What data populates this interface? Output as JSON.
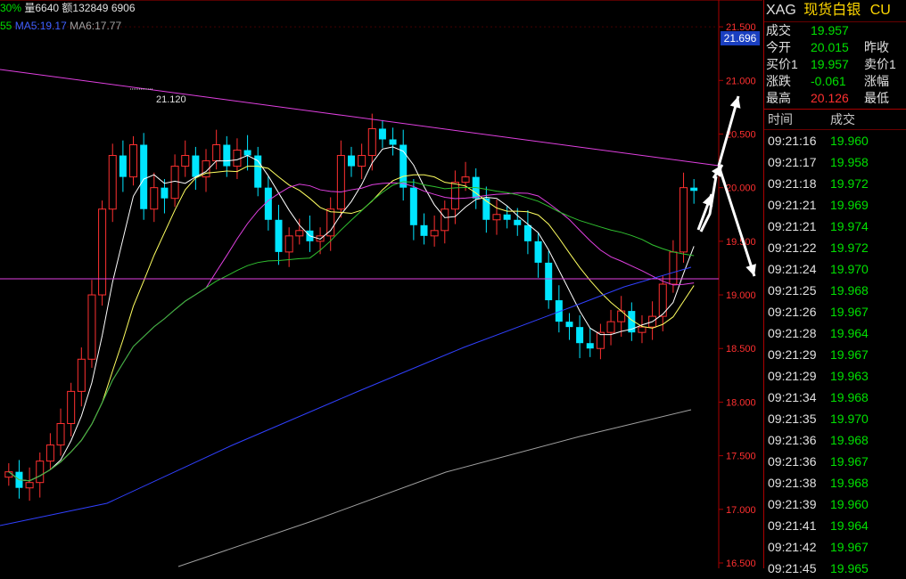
{
  "header": {
    "pct": "30%",
    "volume_label": "量6640",
    "amount_label": "额132849",
    "extra": "6906"
  },
  "ma_bar": {
    "ma_prefix": "55",
    "ma5": "MA5:19.17",
    "ma6": "MA6:17.77"
  },
  "chart": {
    "current_price_tag": "21.696",
    "high_annotation": "21.120",
    "colors": {
      "up": "#ff3030",
      "down": "#00e5ff",
      "resistance": "#e040e0",
      "support": "#e040e0"
    }
  },
  "chart_data": {
    "type": "candlestick",
    "y_ticks": [
      "21.500",
      "21.000",
      "20.500",
      "20.000",
      "19.500",
      "19.000",
      "18.500",
      "18.000",
      "17.500",
      "17.000",
      "16.500"
    ],
    "ylim": [
      16.45,
      21.75
    ]
  },
  "quote": {
    "symbol": "XAG",
    "name": "现货白银",
    "suffix": "CU",
    "rows": [
      {
        "l1": "成交",
        "v1": "19.957",
        "l2": "",
        "c": "green"
      },
      {
        "l1": "今开",
        "v1": "20.015",
        "l2": "昨收",
        "c": "green"
      },
      {
        "l1": "买价1",
        "v1": "19.957",
        "l2": "卖价1",
        "c": "green"
      },
      {
        "l1": "涨跌",
        "v1": "-0.061",
        "l2": "涨幅",
        "c": "green"
      },
      {
        "l1": "最高",
        "v1": "20.126",
        "l2": "最低",
        "c": "red"
      }
    ],
    "ticks_header": {
      "time": "时间",
      "deal": "成交"
    },
    "ticks": [
      {
        "t": "09:21:16",
        "p": "19.960"
      },
      {
        "t": "09:21:17",
        "p": "19.958"
      },
      {
        "t": "09:21:18",
        "p": "19.972"
      },
      {
        "t": "09:21:21",
        "p": "19.969"
      },
      {
        "t": "09:21:21",
        "p": "19.974"
      },
      {
        "t": "09:21:22",
        "p": "19.972"
      },
      {
        "t": "09:21:24",
        "p": "19.970"
      },
      {
        "t": "09:21:25",
        "p": "19.968"
      },
      {
        "t": "09:21:26",
        "p": "19.967"
      },
      {
        "t": "09:21:28",
        "p": "19.964"
      },
      {
        "t": "09:21:29",
        "p": "19.967"
      },
      {
        "t": "09:21:29",
        "p": "19.963"
      },
      {
        "t": "09:21:34",
        "p": "19.968"
      },
      {
        "t": "09:21:35",
        "p": "19.970"
      },
      {
        "t": "09:21:36",
        "p": "19.968"
      },
      {
        "t": "09:21:36",
        "p": "19.967"
      },
      {
        "t": "09:21:38",
        "p": "19.968"
      },
      {
        "t": "09:21:39",
        "p": "19.960"
      },
      {
        "t": "09:21:41",
        "p": "19.964"
      },
      {
        "t": "09:21:42",
        "p": "19.967"
      },
      {
        "t": "09:21:45",
        "p": "19.965"
      }
    ]
  }
}
